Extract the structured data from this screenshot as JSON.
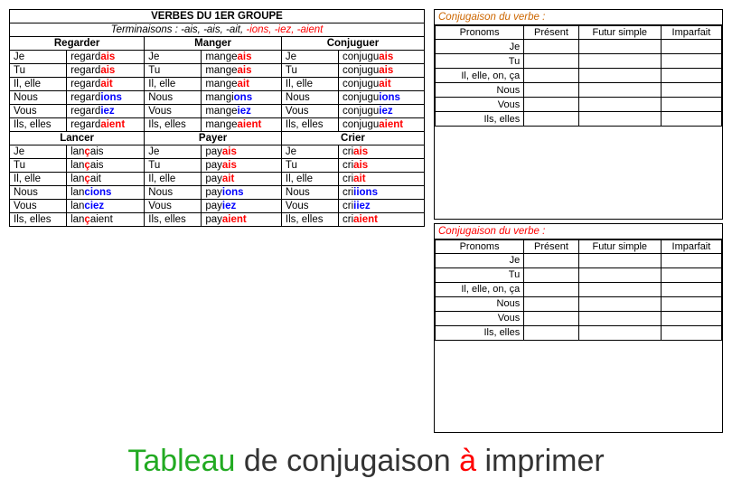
{
  "title": "VERBES DU 1ER GROUPE",
  "subtitle_prefix": "Terminaisons : -ais, -ais, -ait,",
  "subtitle_suffix": "-ions, -iez, -aient",
  "sections": [
    {
      "name": "Regarder",
      "rows": [
        {
          "pronoun": "Je",
          "base": "regard",
          "ending": "ais"
        },
        {
          "pronoun": "Tu",
          "base": "regard",
          "ending": "ais"
        },
        {
          "pronoun": "Il, elle",
          "base": "regard",
          "ending": "ait"
        },
        {
          "pronoun": "Nous",
          "base": "regard",
          "ending": "ions",
          "endingColor": "blue"
        },
        {
          "pronoun": "Vous",
          "base": "regard",
          "ending": "iez",
          "endingColor": "blue"
        },
        {
          "pronoun": "Ils, elles",
          "base": "regard",
          "ending": "aient"
        }
      ]
    },
    {
      "name": "Manger",
      "rows": [
        {
          "pronoun": "Je",
          "base": "mange",
          "ending": "ais"
        },
        {
          "pronoun": "Tu",
          "base": "mange",
          "ending": "ais"
        },
        {
          "pronoun": "Il, elle",
          "base": "mange",
          "ending": "ait"
        },
        {
          "pronoun": "Nous",
          "base": "mangi",
          "ending": "ons",
          "endingColor": "blue"
        },
        {
          "pronoun": "Vous",
          "base": "mange",
          "ending": "iez",
          "endingColor": "blue"
        },
        {
          "pronoun": "Ils, elles",
          "base": "mange",
          "ending": "aient"
        }
      ]
    },
    {
      "name": "Conjuguer",
      "rows": [
        {
          "pronoun": "Je",
          "base": "conjugu",
          "ending": "ais"
        },
        {
          "pronoun": "Tu",
          "base": "conjugu",
          "ending": "ais"
        },
        {
          "pronoun": "Il, elle",
          "base": "conjugu",
          "ending": "ait"
        },
        {
          "pronoun": "Nous",
          "base": "conjugu",
          "ending": "ions",
          "endingColor": "blue"
        },
        {
          "pronoun": "Vous",
          "base": "conjugu",
          "ending": "iez",
          "endingColor": "blue"
        },
        {
          "pronoun": "Ils, elles",
          "base": "conjugu",
          "ending": "aient"
        }
      ]
    },
    {
      "name": "Lancer",
      "rows": [
        {
          "pronoun": "Je",
          "base": "lan",
          "endingMid": "ç",
          "ending": "ais"
        },
        {
          "pronoun": "Tu",
          "base": "lan",
          "endingMid": "ç",
          "ending": "ais"
        },
        {
          "pronoun": "Il, elle",
          "base": "lan",
          "endingMid": "ç",
          "ending": "ait"
        },
        {
          "pronoun": "Nous",
          "base": "lan",
          "ending": "cions",
          "endingColor": "blue"
        },
        {
          "pronoun": "Vous",
          "base": "lan",
          "ending": "ciez",
          "endingColor": "blue"
        },
        {
          "pronoun": "Ils, elles",
          "base": "lan",
          "endingMid": "ç",
          "ending": "aient"
        }
      ]
    },
    {
      "name": "Payer",
      "rows": [
        {
          "pronoun": "Je",
          "base": "pay",
          "ending": "ais"
        },
        {
          "pronoun": "Tu",
          "base": "pay",
          "ending": "ais"
        },
        {
          "pronoun": "Il, elle",
          "base": "pay",
          "ending": "ait"
        },
        {
          "pronoun": "Nous",
          "base": "pay",
          "ending": "ions",
          "endingColor": "blue"
        },
        {
          "pronoun": "Vous",
          "base": "pay",
          "ending": "iez",
          "endingColor": "blue"
        },
        {
          "pronoun": "Ils, elles",
          "base": "pay",
          "ending": "aient"
        }
      ]
    },
    {
      "name": "Crier",
      "rows": [
        {
          "pronoun": "Je",
          "base": "cri",
          "ending": "ais"
        },
        {
          "pronoun": "Tu",
          "base": "cri",
          "ending": "ais"
        },
        {
          "pronoun": "Il, elle",
          "base": "cri",
          "ending": "ait"
        },
        {
          "pronoun": "Nous",
          "base": "cri",
          "ending": "iions",
          "endingColor": "blue"
        },
        {
          "pronoun": "Vous",
          "base": "cri",
          "ending": "iiez",
          "endingColor": "blue"
        },
        {
          "pronoun": "Ils, elles",
          "base": "cri",
          "ending": "aient"
        }
      ]
    }
  ],
  "conj_tables": [
    {
      "title": "Conjugaison du verbe :",
      "title_color": "orange",
      "headers": [
        "Pronoms",
        "Présent",
        "Futur simple",
        "Imparfait"
      ],
      "pronouns": [
        "Je",
        "Tu",
        "Il, elle, on, ça",
        "Nous",
        "Vous",
        "Ils, elles"
      ]
    },
    {
      "title": "Conjugaison du verbe :",
      "title_color": "red",
      "headers": [
        "Pronoms",
        "Présent",
        "Futur simple",
        "Imparfait"
      ],
      "pronouns": [
        "Je",
        "Tu",
        "Il, elle, on, ça",
        "Nous",
        "Vous",
        "Ils, elles"
      ]
    }
  ],
  "bottom_text": {
    "tableau": "Tableau",
    "de": "de",
    "conjugaison": "conjugaison",
    "a": "à",
    "imprimer": "imprimer"
  }
}
